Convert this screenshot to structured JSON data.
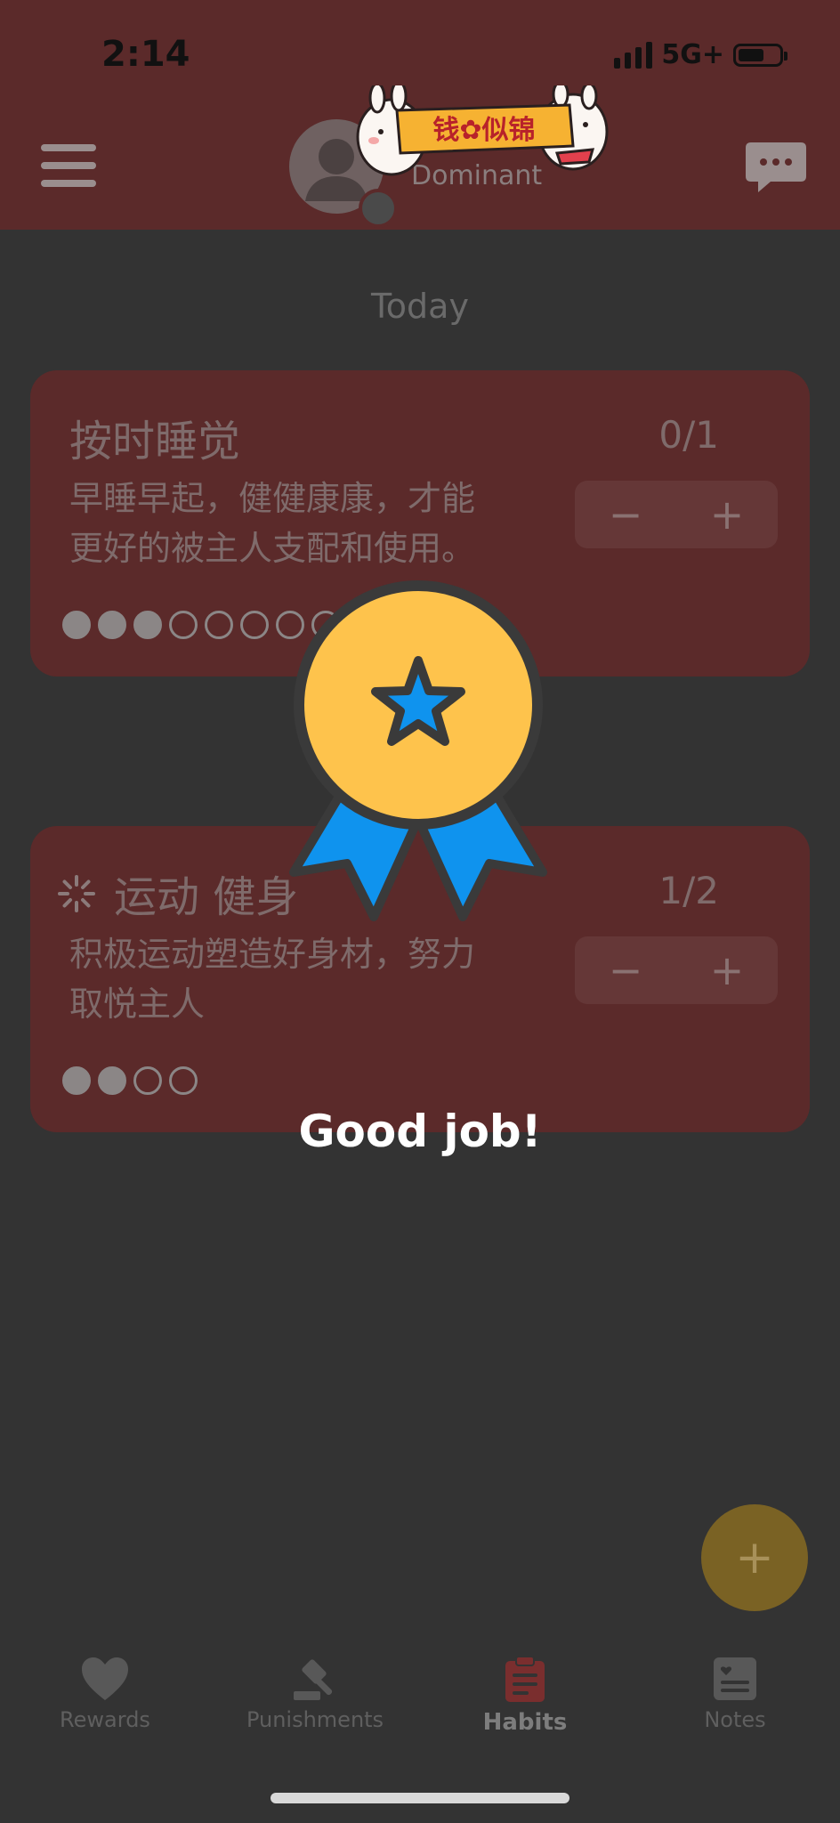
{
  "status_bar": {
    "time": "2:14",
    "network": "5G+",
    "battery_fraction": 0.6
  },
  "header": {
    "role": "Dominant",
    "sticker_text": "钱✿似锦"
  },
  "section": {
    "title": "Today"
  },
  "habits": [
    {
      "title": "按时睡觉",
      "description_line1": "早睡早起，健健康康，才能",
      "description_line2": "更好的被主人支配和使用。",
      "count": "0/1",
      "dots_filled": 3,
      "dots_total": 12
    },
    {
      "title": "运动 健身",
      "description_line1": "积极运动塑造好身材，努力",
      "description_line2": "取悦主人",
      "count": "1/2",
      "dots_filled": 2,
      "dots_total": 4
    }
  ],
  "stepper": {
    "minus": "−",
    "plus": "+"
  },
  "overlay": {
    "message": "Good job!"
  },
  "fab": {
    "label": "+"
  },
  "nav": [
    {
      "label": "Rewards",
      "icon": "heart-icon",
      "active": false
    },
    {
      "label": "Punishments",
      "icon": "gavel-icon",
      "active": false
    },
    {
      "label": "Habits",
      "icon": "clipboard-icon",
      "active": true
    },
    {
      "label": "Notes",
      "icon": "note-icon",
      "active": false
    }
  ],
  "colors": {
    "header": "#5b2a2a",
    "card": "#5b2a2a",
    "background": "#333333",
    "medal_gold": "#fec34c",
    "medal_ribbon": "#0f93ee",
    "fab": "#7a6224",
    "active_nav": "#7a2e2e"
  }
}
